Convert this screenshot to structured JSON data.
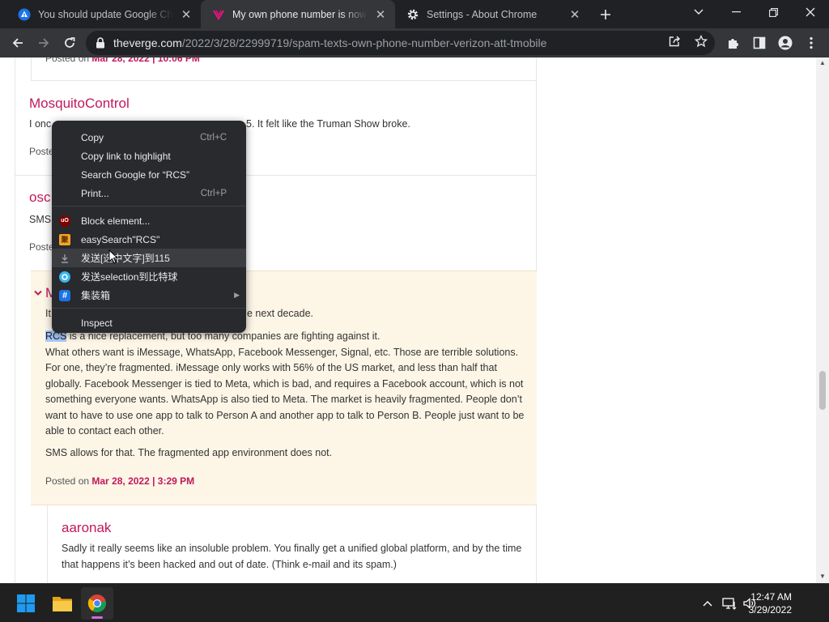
{
  "browser": {
    "tabs": [
      {
        "title": "You should update Google Chrome",
        "icon": "chrome-update-icon",
        "active": false
      },
      {
        "title": "My own phone number is now spamming me",
        "icon": "the-verge-icon",
        "active": true
      },
      {
        "title": "Settings - About Chrome",
        "icon": "settings-gear-icon",
        "active": false
      }
    ],
    "url_host": "theverge.com",
    "url_path": "/2022/3/28/22999719/spam-texts-own-phone-number-verizon-att-tmobile"
  },
  "page": {
    "top_posted_label": "Posted  on",
    "top_posted_date": "Mar 28, 2022 | 10:06 PM",
    "comment1_author": "MosquitoControl",
    "comment1_text_start": "I onc",
    "comment1_text_end": "5. It felt like the Truman Show broke.",
    "comment1_posted_fragment": "Poste",
    "comment2_author_fragment": "osc",
    "comment2_text_fragment": "SMS",
    "comment2_posted_fragment": "Poste",
    "comment3_collapse_glyph": "⌄",
    "comment3_author_fragment": "M",
    "comment3_line1_start": "It",
    "comment3_line1_end": "e next decade.",
    "comment3_selected": "RCS",
    "comment3_line2_rest": " is a nice replacement, but too many companies are fighting against it.",
    "comment3_para": "What others want is iMessage, WhatsApp, Facebook Messenger, Signal, etc. Those are terrible solutions. For one, they’re fragmented. iMessage only works with 56% of the US market, and less than half that globally. Facebook Messenger is tied to Meta, which is bad, and requires a Facebook account, which is not something everyone wants. WhatsApp is also tied to Meta. The market is heavily fragmented. People don’t want to have to use one app to talk to Person A and another app to talk to Person B. People just want to be able to contact each other.",
    "comment3_para2": "SMS allows for that. The fragmented app environment does not.",
    "comment3_posted_label": "Posted  on",
    "comment3_posted_date": "Mar 28, 2022 | 3:29 PM",
    "comment4_author": "aaronak",
    "comment4_text": "Sadly it really seems like an insoluble problem. You finally get a unified global platform, and by the time that happens it’s been hacked and out of date. (Think e-mail and its spam.)"
  },
  "context_menu": {
    "items": [
      {
        "label": "Copy",
        "shortcut": "Ctrl+C"
      },
      {
        "label": "Copy link to highlight",
        "shortcut": ""
      },
      {
        "label": "Search Google for “RCS”",
        "shortcut": ""
      },
      {
        "label": "Print...",
        "shortcut": "Ctrl+P"
      },
      {
        "label": "Block element...",
        "icon": "ublock-origin-icon"
      },
      {
        "label": "easySearch\"RCS\"",
        "icon": "easysearch-icon"
      },
      {
        "label": "发送[选中文字]到115",
        "icon": "download-arrow-icon"
      },
      {
        "label": "发送selection到比特球",
        "icon": "bitball-icon"
      },
      {
        "label": "集装箱",
        "icon": "hash-icon",
        "submenu": true
      },
      {
        "label": "Inspect"
      }
    ]
  },
  "taskbar": {
    "time": "12:47 AM",
    "date": "3/29/2022"
  },
  "colors": {
    "chrome_dark": "#202124",
    "toolbar": "#35363a",
    "verge_pink": "#c2185b",
    "highlight_bg": "#fdf6e7",
    "menu_bg": "#292a2d"
  }
}
